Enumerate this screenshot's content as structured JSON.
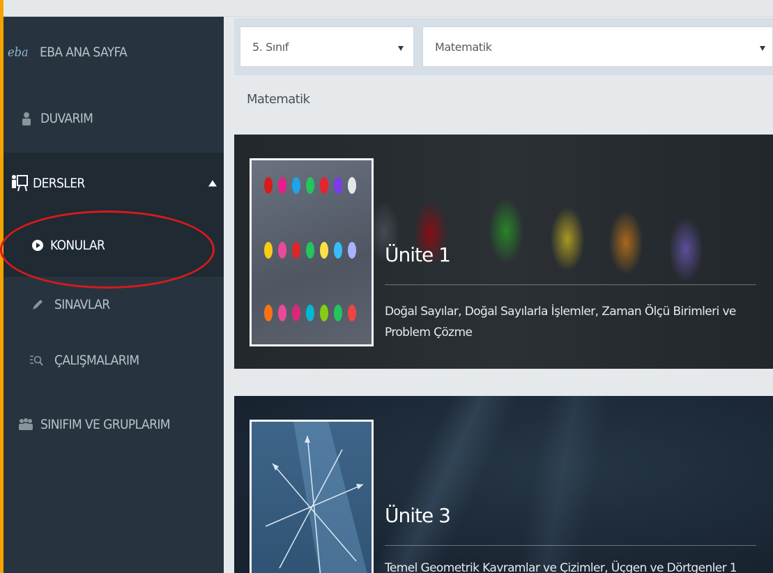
{
  "sidebar": {
    "logo": "eba",
    "items": [
      {
        "label": "EBA ANA SAYFA",
        "icon": "eba-logo-icon"
      },
      {
        "label": "DUVARIM",
        "icon": "user-icon"
      },
      {
        "label": "DERSLER",
        "icon": "classroom-icon"
      },
      {
        "label": "KONULAR",
        "icon": "play-circle-icon"
      },
      {
        "label": "SINAVLAR",
        "icon": "pencil-icon"
      },
      {
        "label": "ÇALIŞMALARIM",
        "icon": "search-list-icon"
      },
      {
        "label": "SINIFIM VE GRUPLARIM",
        "icon": "group-icon"
      }
    ]
  },
  "filters": {
    "grade": "5. Sınıf",
    "subject": "Matematik"
  },
  "breadcrumb": "Matematik",
  "units": [
    {
      "title": "Ünite 1",
      "description": "Doğal Sayılar, Doğal Sayılarla İşlemler, Zaman Ölçü Birimleri ve Problem Çözme"
    },
    {
      "title": "Ünite 3",
      "description": "Temel Geometrik Kavramlar ve Çizimler, Üçgen ve Dörtgenler 1"
    }
  ],
  "colors": {
    "sidebar": "#27343f",
    "sidebar_active": "#1f2a33",
    "accent_stripe": "#f5a300",
    "highlight_oval": "#d91a1a"
  }
}
